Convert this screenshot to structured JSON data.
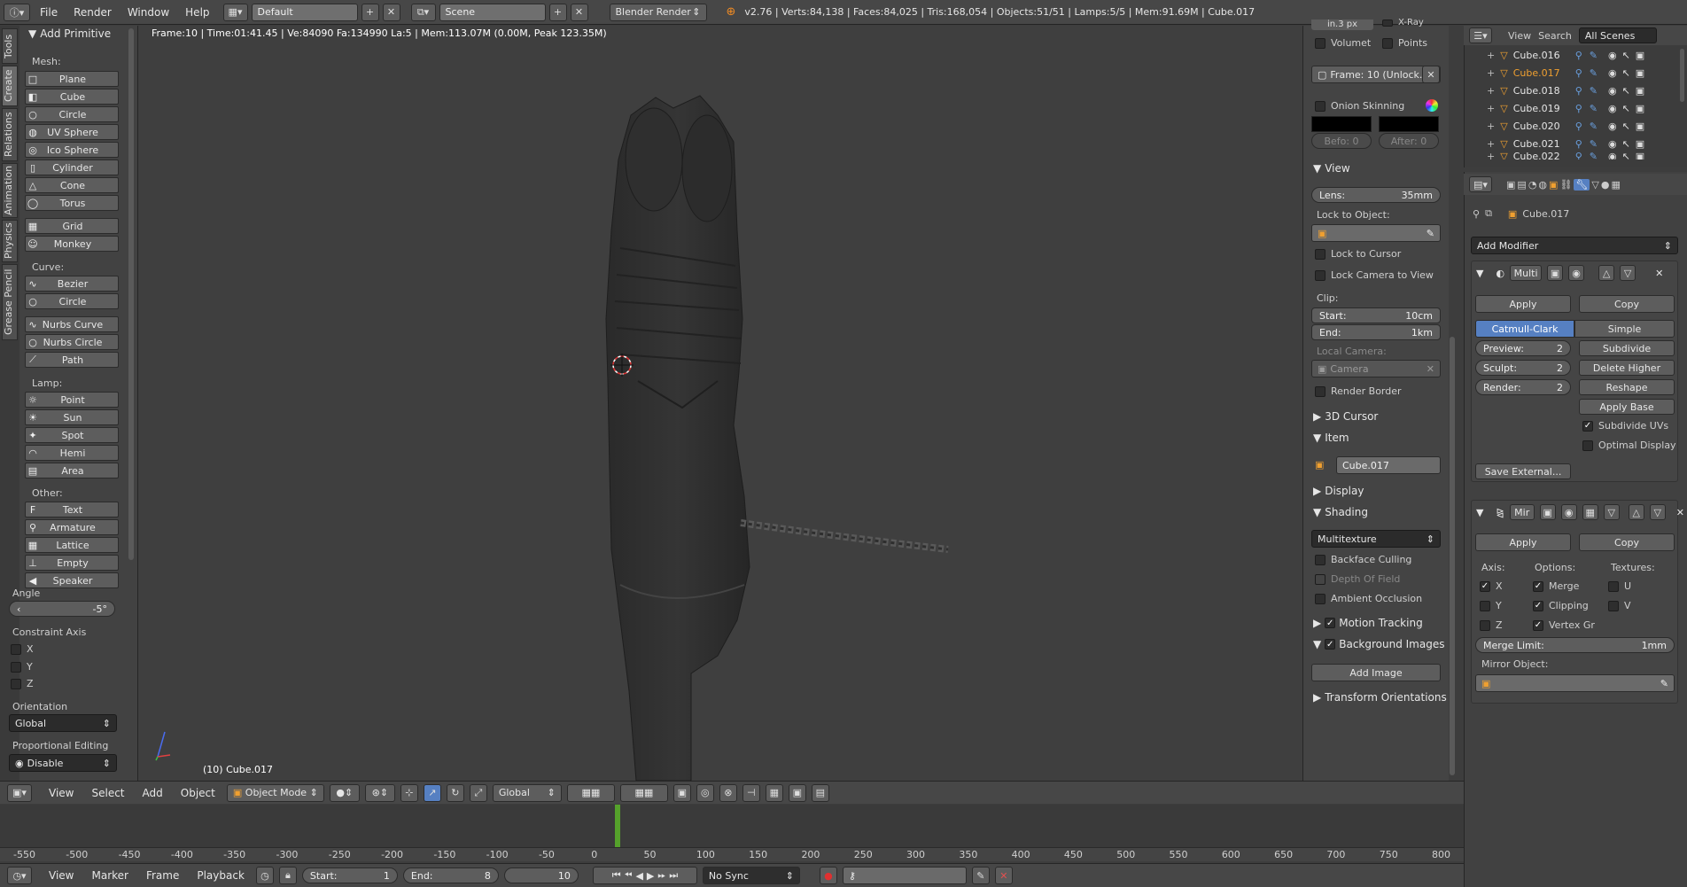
{
  "topbar": {
    "menus": [
      "File",
      "Render",
      "Window",
      "Help"
    ],
    "layout": "Default",
    "scene": "Scene",
    "engine": "Blender Render",
    "stats": "v2.76 | Verts:84,138 | Faces:84,025 | Tris:168,054 | Objects:51/51 | Lamps:5/5 | Mem:91.69M | Cube.017"
  },
  "viewport": {
    "info": "Frame:10 | Time:01:41.45 | Ve:84090 Fa:134990 La:5 | Mem:113.07M (0.00M, Peak 123.35M)",
    "object_label": "(10) Cube.017"
  },
  "tool_tabs": [
    "Tools",
    "Create",
    "Relations",
    "Animation",
    "Physics",
    "Grease Pencil"
  ],
  "tools": {
    "header": "Add Primitive",
    "mesh_label": "Mesh:",
    "mesh": [
      {
        "label": "Plane",
        "icon": "plane-icon",
        "glyph": "□"
      },
      {
        "label": "Cube",
        "icon": "cube-icon",
        "glyph": "◧"
      },
      {
        "label": "Circle",
        "icon": "circle-icon",
        "glyph": "○"
      },
      {
        "label": "UV Sphere",
        "icon": "uv-sphere-icon",
        "glyph": "◍"
      },
      {
        "label": "Ico Sphere",
        "icon": "ico-sphere-icon",
        "glyph": "◎"
      },
      {
        "label": "Cylinder",
        "icon": "cylinder-icon",
        "glyph": "▯"
      },
      {
        "label": "Cone",
        "icon": "cone-icon",
        "glyph": "△"
      },
      {
        "label": "Torus",
        "icon": "torus-icon",
        "glyph": "◯"
      }
    ],
    "mesh2": [
      {
        "label": "Grid",
        "icon": "grid-icon",
        "glyph": "▦"
      },
      {
        "label": "Monkey",
        "icon": "monkey-icon",
        "glyph": "☺"
      }
    ],
    "curve_label": "Curve:",
    "curve": [
      {
        "label": "Bezier",
        "icon": "bezier-icon",
        "glyph": "∿"
      },
      {
        "label": "Circle",
        "icon": "curve-circle-icon",
        "glyph": "○"
      }
    ],
    "curve2": [
      {
        "label": "Nurbs Curve",
        "icon": "nurbs-curve-icon",
        "glyph": "∿"
      },
      {
        "label": "Nurbs Circle",
        "icon": "nurbs-circle-icon",
        "glyph": "○"
      },
      {
        "label": "Path",
        "icon": "path-icon",
        "glyph": "⟋"
      }
    ],
    "lamp_label": "Lamp:",
    "lamp": [
      {
        "label": "Point",
        "icon": "point-lamp-icon",
        "glyph": "☼"
      },
      {
        "label": "Sun",
        "icon": "sun-lamp-icon",
        "glyph": "☀"
      },
      {
        "label": "Spot",
        "icon": "spot-lamp-icon",
        "glyph": "✦"
      },
      {
        "label": "Hemi",
        "icon": "hemi-lamp-icon",
        "glyph": "◠"
      },
      {
        "label": "Area",
        "icon": "area-lamp-icon",
        "glyph": "▤"
      }
    ],
    "other_label": "Other:",
    "other": [
      {
        "label": "Text",
        "icon": "text-icon",
        "glyph": "F"
      },
      {
        "label": "Armature",
        "icon": "armature-icon",
        "glyph": "⚲"
      },
      {
        "label": "Lattice",
        "icon": "lattice-icon",
        "glyph": "▦"
      },
      {
        "label": "Empty",
        "icon": "empty-icon",
        "glyph": "⊥"
      },
      {
        "label": "Speaker",
        "icon": "speaker-icon",
        "glyph": "◀"
      }
    ]
  },
  "operator": {
    "angle_label": "Angle",
    "angle_value": "-5°",
    "constraint_label": "Constraint Axis",
    "axes": [
      "X",
      "Y",
      "Z"
    ],
    "orientation_label": "Orientation",
    "orientation_value": "Global",
    "prop_label": "Proportional Editing",
    "prop_value": "Disable"
  },
  "npanel": {
    "top_partial": "in.3 px",
    "xray": "X-Ray",
    "volumet": "Volumet",
    "points": "Points",
    "frame": "Frame: 10 (Unlock...",
    "onion": "Onion Skinning",
    "before": "Befo: 0",
    "after": "After: 0",
    "view_header": "View",
    "lens_label": "Lens:",
    "lens_value": "35mm",
    "lock_to_object": "Lock to Object:",
    "lock_cursor": "Lock to Cursor",
    "lock_camera": "Lock Camera to View",
    "clip": "Clip:",
    "start_label": "Start:",
    "start_value": "10cm",
    "end_label": "End:",
    "end_value": "1km",
    "local_camera": "Local Camera:",
    "camera": "Camera",
    "render_border": "Render Border",
    "cursor_header": "3D Cursor",
    "item_header": "Item",
    "item_name": "Cube.017",
    "display_header": "Display",
    "shading_header": "Shading",
    "shading_mode": "Multitexture",
    "backface": "Backface Culling",
    "dof": "Depth Of Field",
    "ao": "Ambient Occlusion",
    "motion": "Motion Tracking",
    "bg_images": "Background Images",
    "add_image": "Add Image",
    "transform_orient": "Transform Orientations"
  },
  "outliner": {
    "view": "View",
    "search": "Search",
    "scenes": "All Scenes",
    "items": [
      "Cube.016",
      "Cube.017",
      "Cube.018",
      "Cube.019",
      "Cube.020",
      "Cube.021",
      "Cube.022"
    ]
  },
  "properties": {
    "object": "Cube.017",
    "add_modifier": "Add Modifier",
    "multires": {
      "name": "Multi",
      "apply": "Apply",
      "copy": "Copy",
      "catmull": "Catmull-Clark",
      "simple": "Simple",
      "preview_label": "Preview:",
      "preview_value": "2",
      "sculpt_label": "Sculpt:",
      "sculpt_value": "2",
      "render_label": "Render:",
      "render_value": "2",
      "subdivide": "Subdivide",
      "delete_higher": "Delete Higher",
      "reshape": "Reshape",
      "apply_base": "Apply Base",
      "subdivide_uvs": "Subdivide UVs",
      "optimal_display": "Optimal Display",
      "save_external": "Save External..."
    },
    "mirror": {
      "name": "Mir",
      "apply": "Apply",
      "copy": "Copy",
      "axis_label": "Axis:",
      "options_label": "Options:",
      "textures_label": "Textures:",
      "axes": [
        "X",
        "Y",
        "Z"
      ],
      "options": [
        "Merge",
        "Clipping",
        "Vertex Gr"
      ],
      "textures": [
        "U",
        "V"
      ],
      "merge_limit_label": "Merge Limit:",
      "merge_limit_value": "1mm",
      "mirror_object": "Mirror Object:"
    }
  },
  "viewheader": {
    "menus": [
      "View",
      "Select",
      "Add",
      "Object"
    ],
    "mode": "Object Mode",
    "orientation": "Global"
  },
  "timeline": {
    "ticks": [
      "-550",
      "-500",
      "-450",
      "-400",
      "-350",
      "-300",
      "-250",
      "-200",
      "-150",
      "-100",
      "-50",
      "0",
      "50",
      "100",
      "150",
      "200",
      "250",
      "300",
      "350",
      "400",
      "450",
      "500",
      "550",
      "600",
      "650",
      "700",
      "750",
      "800"
    ],
    "menus": [
      "View",
      "Marker",
      "Frame",
      "Playback"
    ],
    "start_label": "Start:",
    "start_value": "1",
    "end_label": "End:",
    "end_value": "8",
    "current": "10",
    "sync": "No Sync"
  }
}
